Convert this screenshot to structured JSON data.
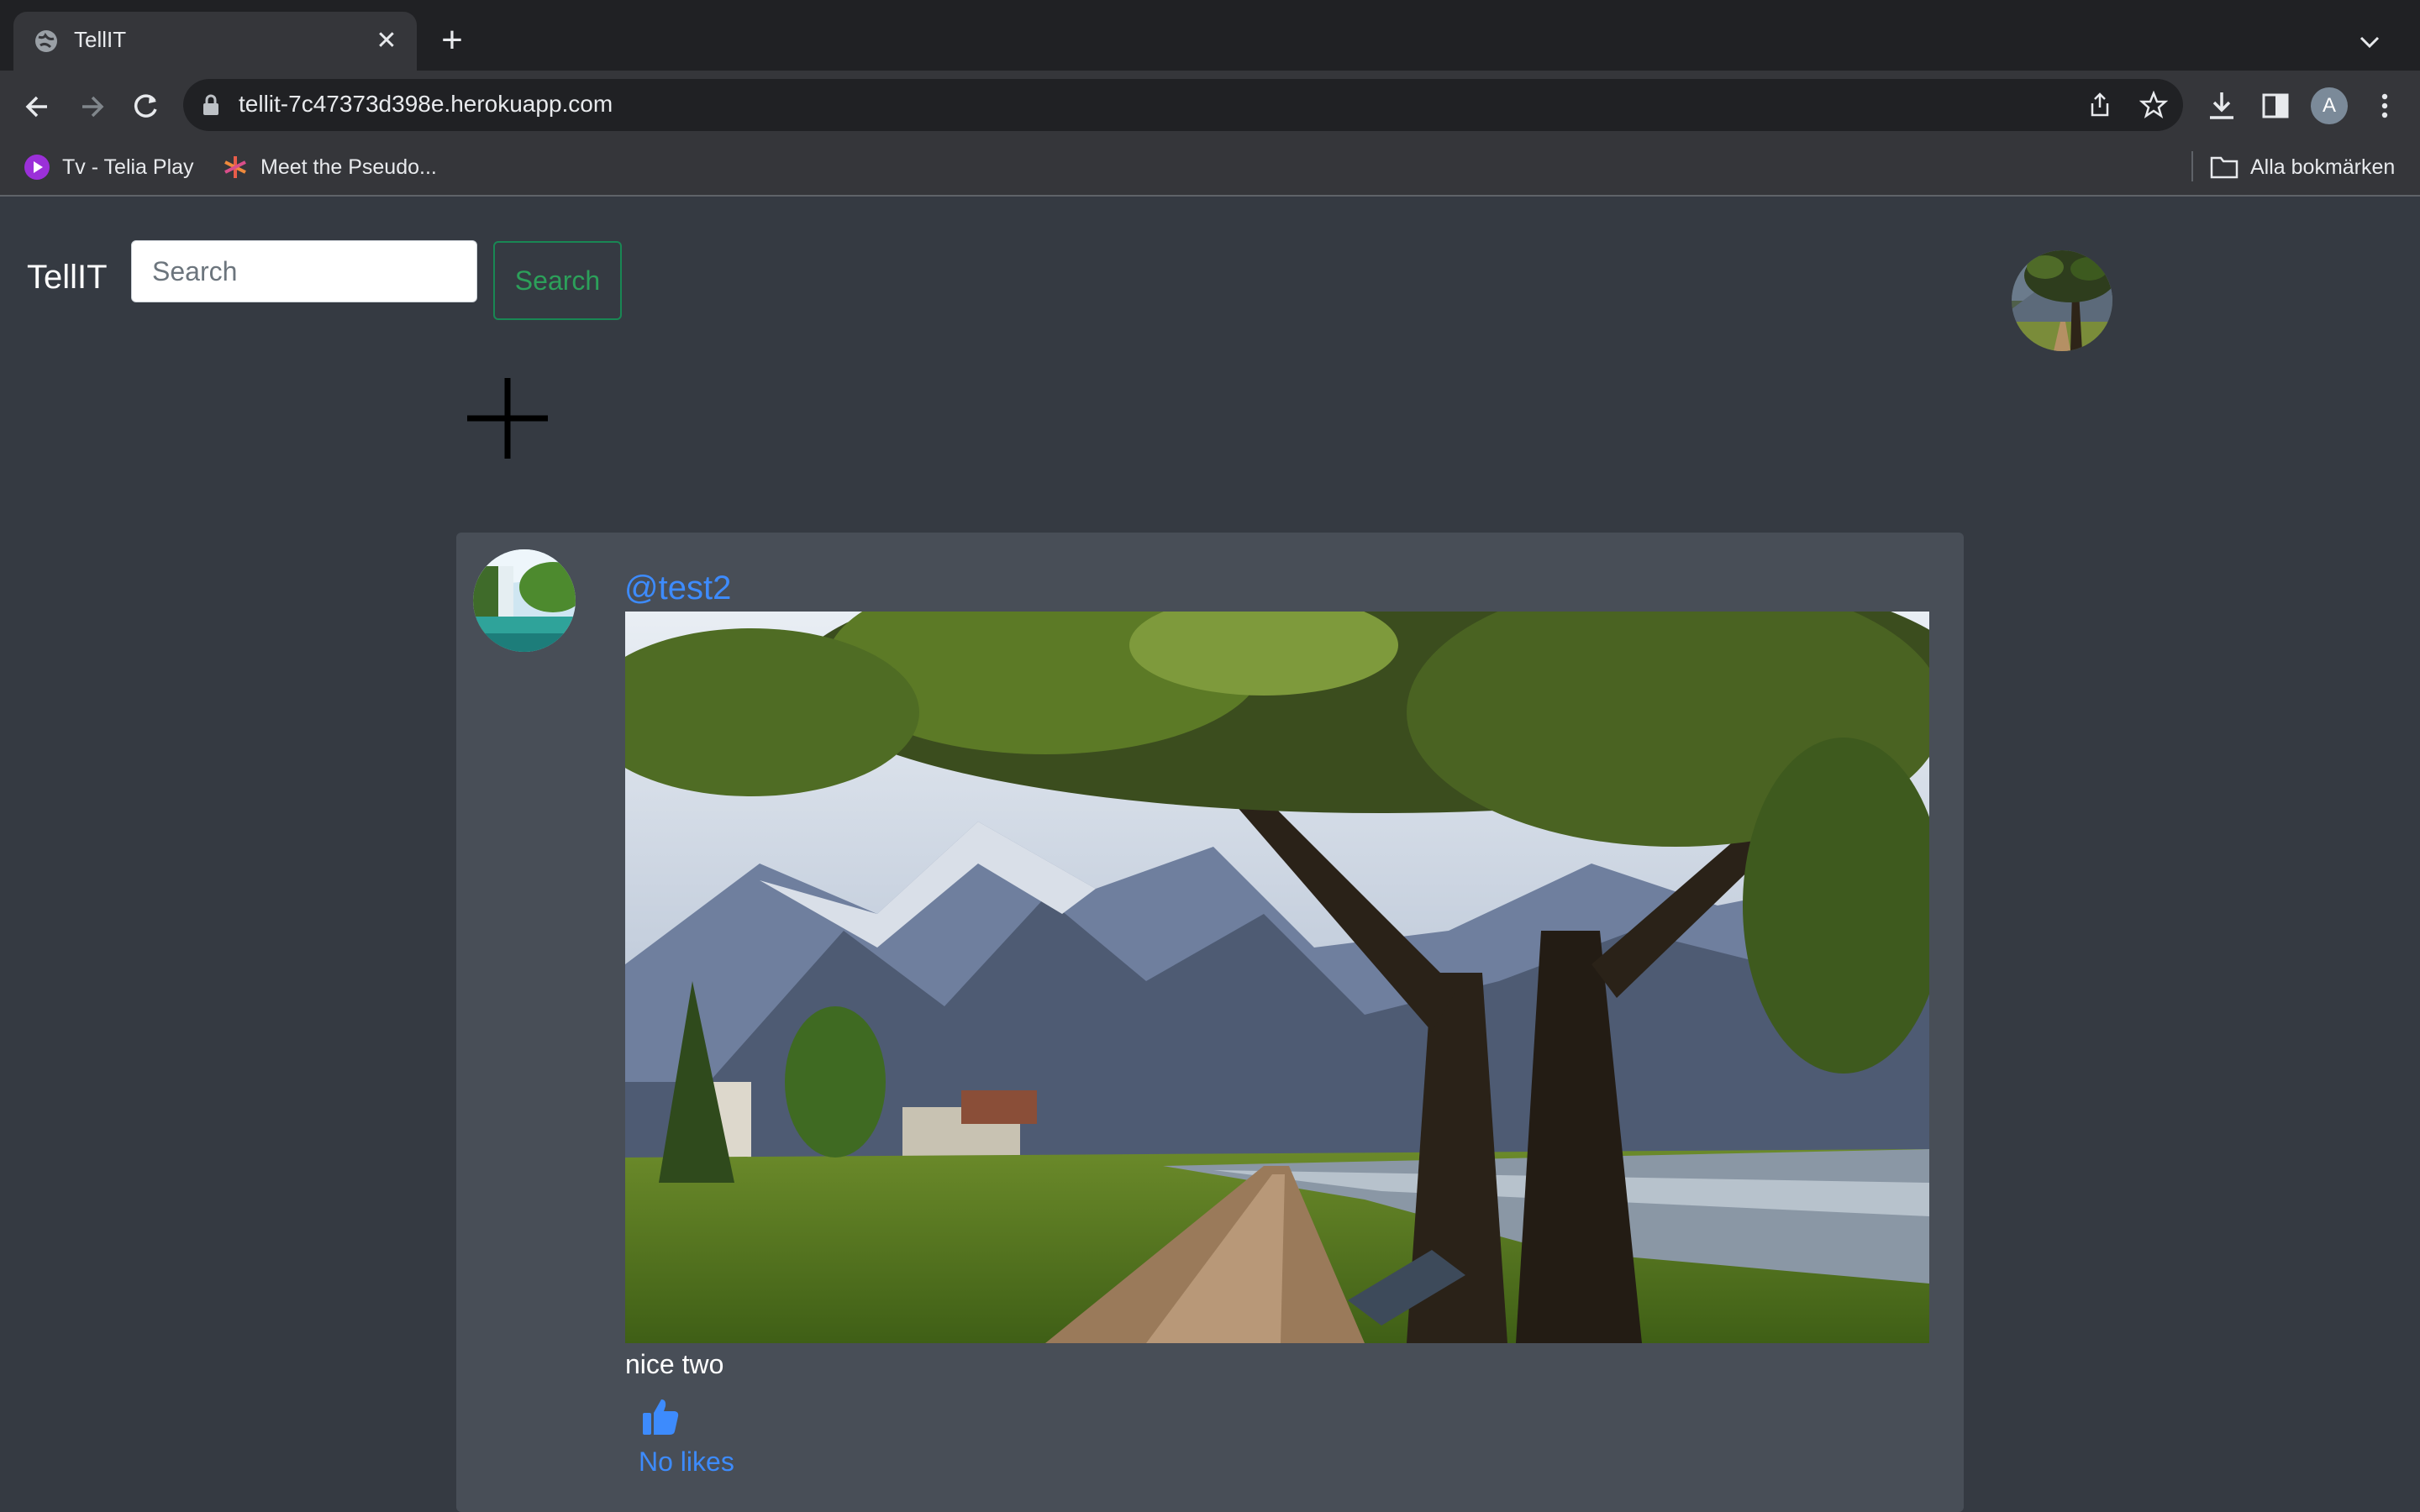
{
  "browser": {
    "tab_title": "TellIT",
    "url": "tellit-7c47373d398e.herokuapp.com",
    "bookmarks": [
      {
        "label": "Tv - Telia Play",
        "icon": "telia-play-icon"
      },
      {
        "label": "Meet the Pseudo...",
        "icon": "asterisk-icon"
      }
    ],
    "all_bookmarks_label": "Alla bokmärken",
    "profile_initial": "A"
  },
  "app": {
    "brand": "TellIT",
    "search": {
      "placeholder": "Search",
      "button_label": "Search"
    }
  },
  "posts": [
    {
      "username": "@test2",
      "caption": "nice two",
      "likes_label": "No likes"
    }
  ],
  "colors": {
    "page_bg": "#353a42",
    "card_bg": "#484e57",
    "link_blue": "#3d8bfd",
    "search_green": "#198754"
  }
}
